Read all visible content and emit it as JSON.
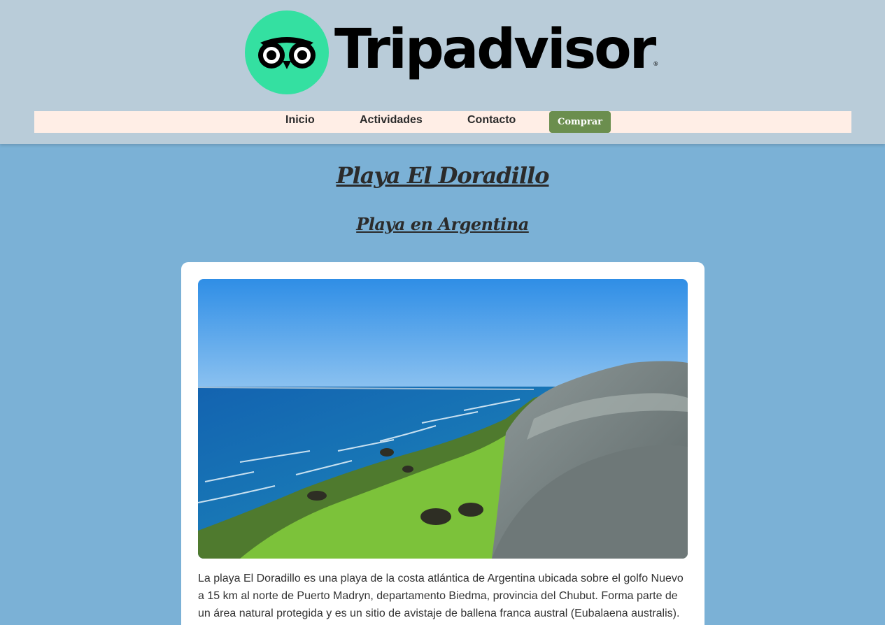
{
  "header": {
    "logo_text": "Tripadvisor",
    "logo_registered": "®",
    "logo_icon": "owl-eyes-icon",
    "brand_color": "#34e0a1"
  },
  "nav": {
    "items": [
      {
        "label": "Inicio"
      },
      {
        "label": "Actividades"
      },
      {
        "label": "Contacto"
      }
    ],
    "buy_label": "Comprar",
    "buy_color": "#6b8e4e"
  },
  "main": {
    "title": "Playa El Doradillo",
    "subtitle": "Playa en Argentina",
    "description": "La playa El Doradillo es una playa de la costa atlántica de Argentina ubicada sobre el golfo Nuevo a 15 km al norte de Puerto Madryn, departamento Biedma, provincia del Chubut. Forma parte de un área natural protegida y es un sitio de avistaje de ballena franca austral (Eubalaena australis)."
  },
  "colors": {
    "page_background": "#7bb1d6",
    "header_background": "#b9ccd9",
    "nav_background": "#ffeee6"
  }
}
